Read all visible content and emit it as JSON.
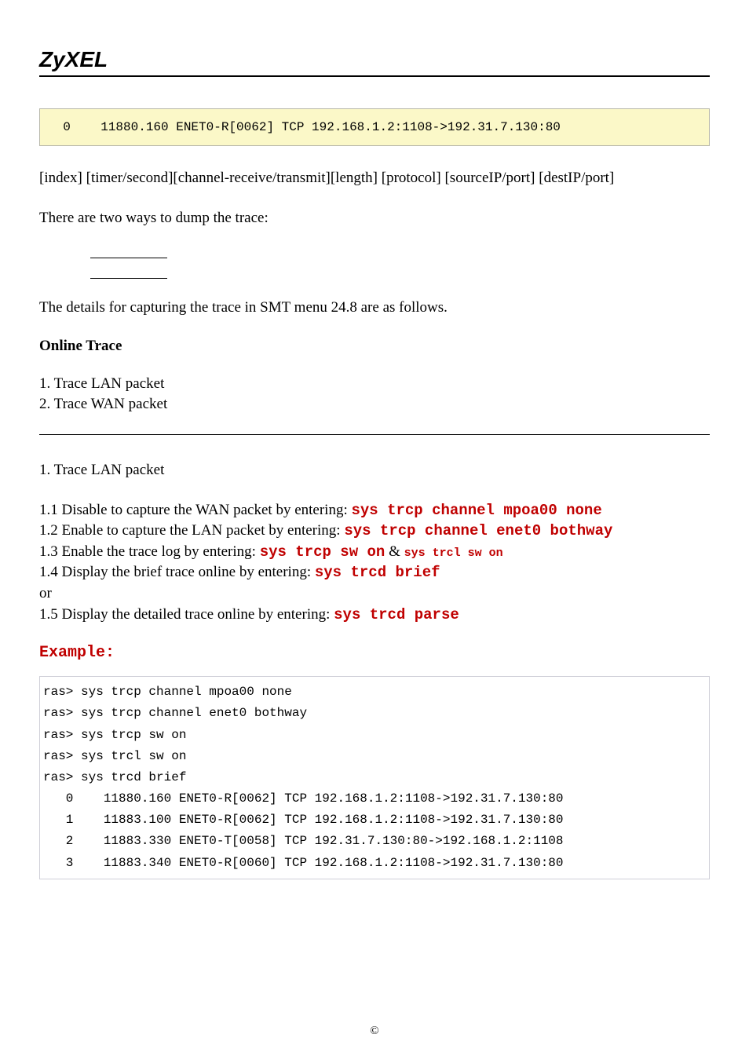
{
  "brand": "ZyXEL",
  "codebox1": "  0    11880.160 ENET0-R[0062] TCP 192.168.1.2:1108->192.31.7.130:80",
  "p_fields": "[index] [timer/second][channel-receive/transmit][length]  [protocol] [sourceIP/port] [destIP/port]",
  "p_twoways": "There are two ways to dump the trace:",
  "p_details": "The details for capturing the trace in SMT menu 24.8 are as follows.",
  "online_trace": "Online Trace",
  "ol_item1": "1. Trace LAN packet",
  "ol_item2": "2. Trace WAN packet",
  "sub_header": "1. Trace LAN packet",
  "s11_pre": "1.1 Disable to capture the WAN packet by entering: ",
  "s11_cmd": "sys trcp channel mpoa00 none",
  "s12_pre": "1.2 Enable to capture the LAN packet by entering: ",
  "s12_cmd": "sys trcp channel enet0 bothway",
  "s13_pre": "1.3 Enable the trace log by entering: ",
  "s13_cmd1": "sys trcp sw on",
  "s13_mid": " & ",
  "s13_cmd2": "sys trcl sw on",
  "s14_pre": "1.4 Display the brief trace online by entering: ",
  "s14_cmd": "sys trcd brief",
  "or": "or",
  "s15_pre": "1.5 Display the detailed trace online by entering: ",
  "s15_cmd": "sys trcd parse",
  "example": "Example:",
  "terminal": "ras> sys trcp channel mpoa00 none\nras> sys trcp channel enet0 bothway\nras> sys trcp sw on\nras> sys trcl sw on\nras> sys trcd brief\n   0    11880.160 ENET0-R[0062] TCP 192.168.1.2:1108->192.31.7.130:80\n   1    11883.100 ENET0-R[0062] TCP 192.168.1.2:1108->192.31.7.130:80\n   2    11883.330 ENET0-T[0058] TCP 192.31.7.130:80->192.168.1.2:1108\n   3    11883.340 ENET0-R[0060] TCP 192.168.1.2:1108->192.31.7.130:80",
  "copyright": "©"
}
